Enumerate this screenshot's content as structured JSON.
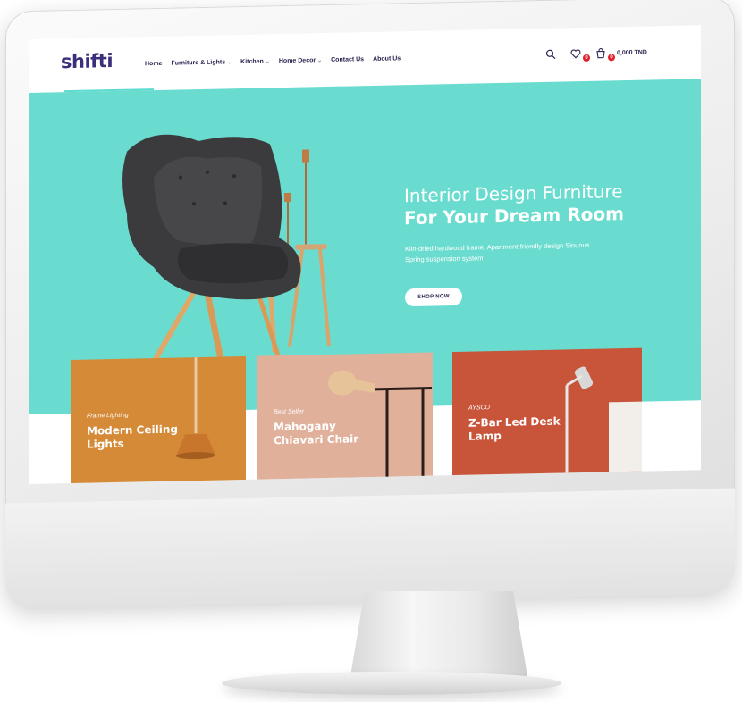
{
  "site": {
    "logo": "shifti",
    "nav": [
      {
        "label": "Home",
        "dropdown": false
      },
      {
        "label": "Furniture & Lights",
        "dropdown": true
      },
      {
        "label": "Kitchen",
        "dropdown": true
      },
      {
        "label": "Home Decor",
        "dropdown": true
      },
      {
        "label": "Contact Us",
        "dropdown": false
      },
      {
        "label": "About Us",
        "dropdown": false
      }
    ],
    "header_icons": {
      "search": "search-icon",
      "wishlist": "heart-icon",
      "wishlist_count": "0",
      "cart": "cart-icon",
      "cart_count": "0",
      "cart_total": "0,000 TND"
    }
  },
  "hero": {
    "title_line1": "Interior Design Furniture",
    "title_line2": "For Your Dream Room",
    "description": "Kiln-dried hardwood frame, Apartment-friendly design Sinuous Spring suspension system",
    "button": "SHOP NOW"
  },
  "cards": [
    {
      "tag": "Frame Lighting",
      "name": "Modern Ceiling Lights"
    },
    {
      "tag": "Best Seller",
      "name": "Mahogany Chiavari Chair"
    },
    {
      "tag": "AYSCO",
      "name": "Z-Bar Led Desk Lamp"
    }
  ],
  "colors": {
    "hero_bg": "#6adccf",
    "brand": "#3a2f7a",
    "card1": "#d58a38",
    "card2": "#e0b09b",
    "card3": "#c8553a",
    "badge": "#e0202c"
  }
}
